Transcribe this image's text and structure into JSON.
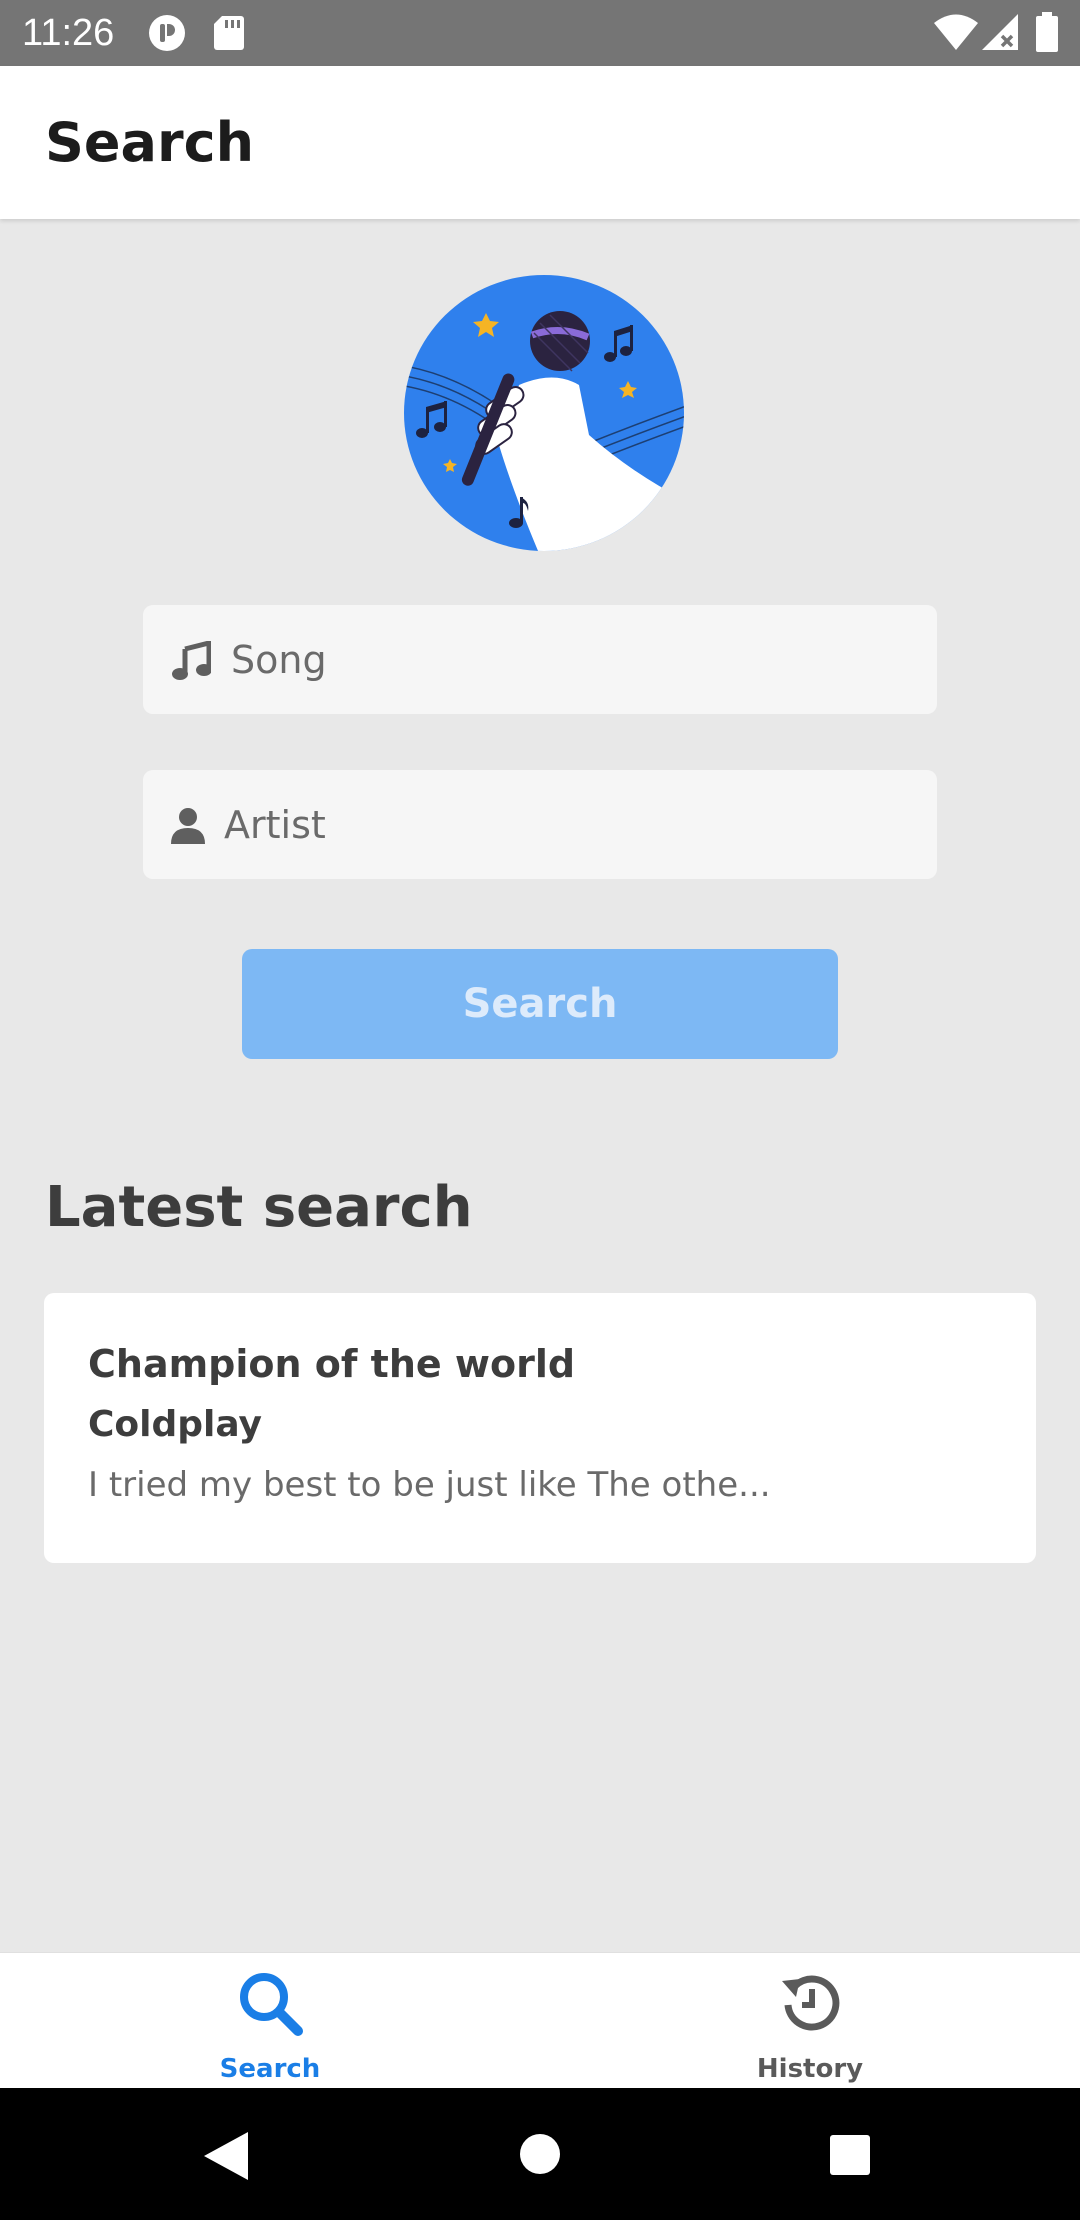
{
  "status_bar": {
    "time": "11:26"
  },
  "header": {
    "title": "Search"
  },
  "form": {
    "song_placeholder": "Song",
    "artist_placeholder": "Artist",
    "search_button_label": "Search"
  },
  "latest": {
    "heading": "Latest search",
    "song": "Champion of the world",
    "artist": "Coldplay",
    "lyrics_snippet": "I tried my best to be just like The othe..."
  },
  "bottom_nav": {
    "items": [
      {
        "label": "Search",
        "icon": "search-icon",
        "active": true
      },
      {
        "label": "History",
        "icon": "history-icon",
        "active": false
      }
    ]
  },
  "colors": {
    "accent": "#1a7ee6",
    "button_disabled": "#7db8f4",
    "hero_blue": "#2f80ed",
    "background": "#e8e8e8"
  }
}
